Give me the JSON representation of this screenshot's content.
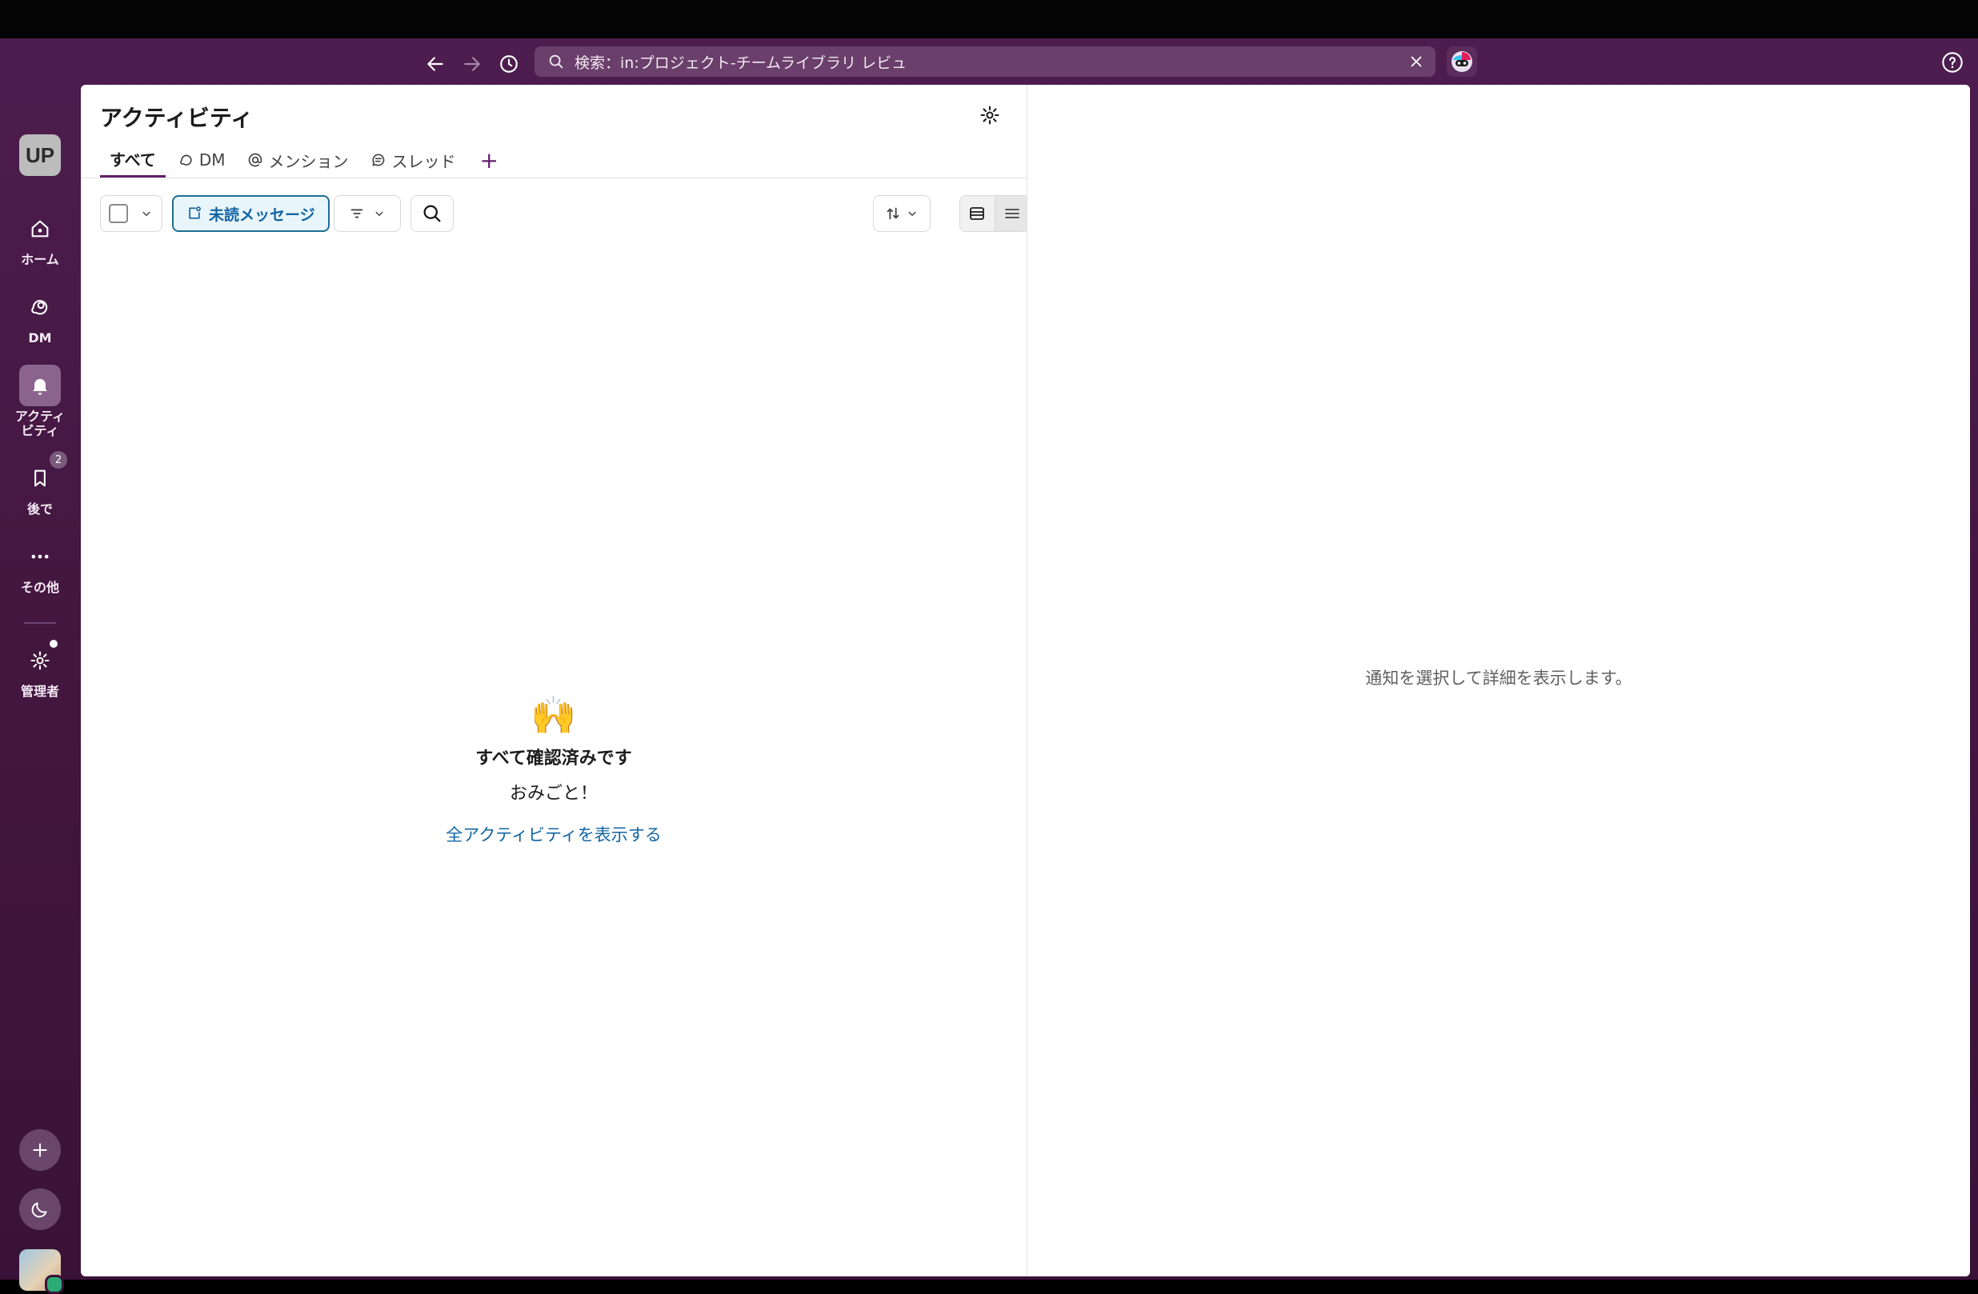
{
  "topbar": {
    "search_text": "検索：in:プロジェクト-チームライブラリ レビュ",
    "back_label": "戻る",
    "forward_label": "進む",
    "history_label": "履歴"
  },
  "workspace": {
    "initials": "UP"
  },
  "rail": {
    "items": [
      {
        "label": "ホーム",
        "icon": "home-icon"
      },
      {
        "label": "DM",
        "icon": "dm-icon"
      },
      {
        "label": "アクティ\nビティ",
        "icon": "bell-icon"
      },
      {
        "label": "後で",
        "icon": "bookmark-icon",
        "badge": "2"
      },
      {
        "label": "その他",
        "icon": "more-icon"
      },
      {
        "label": "管理者",
        "icon": "gear-icon"
      }
    ]
  },
  "activity": {
    "title": "アクティビティ",
    "tabs": [
      {
        "label": "すべて",
        "active": true
      },
      {
        "label": "DM",
        "icon": "dm-icon"
      },
      {
        "label": "メンション",
        "icon": "at-icon"
      },
      {
        "label": "スレッド",
        "icon": "thread-icon"
      }
    ],
    "unread_chip": "未読メッセージ",
    "empty": {
      "emoji": "🙌",
      "title": "すべて確認済みです",
      "subtitle": "おみごと！",
      "link": "全アクティビティを表示する"
    }
  },
  "detail": {
    "placeholder": "通知を選択して詳細を表示します。"
  },
  "colors": {
    "sidebar": "#4d1d4f",
    "accent": "#611f69",
    "link": "#1264a3"
  }
}
